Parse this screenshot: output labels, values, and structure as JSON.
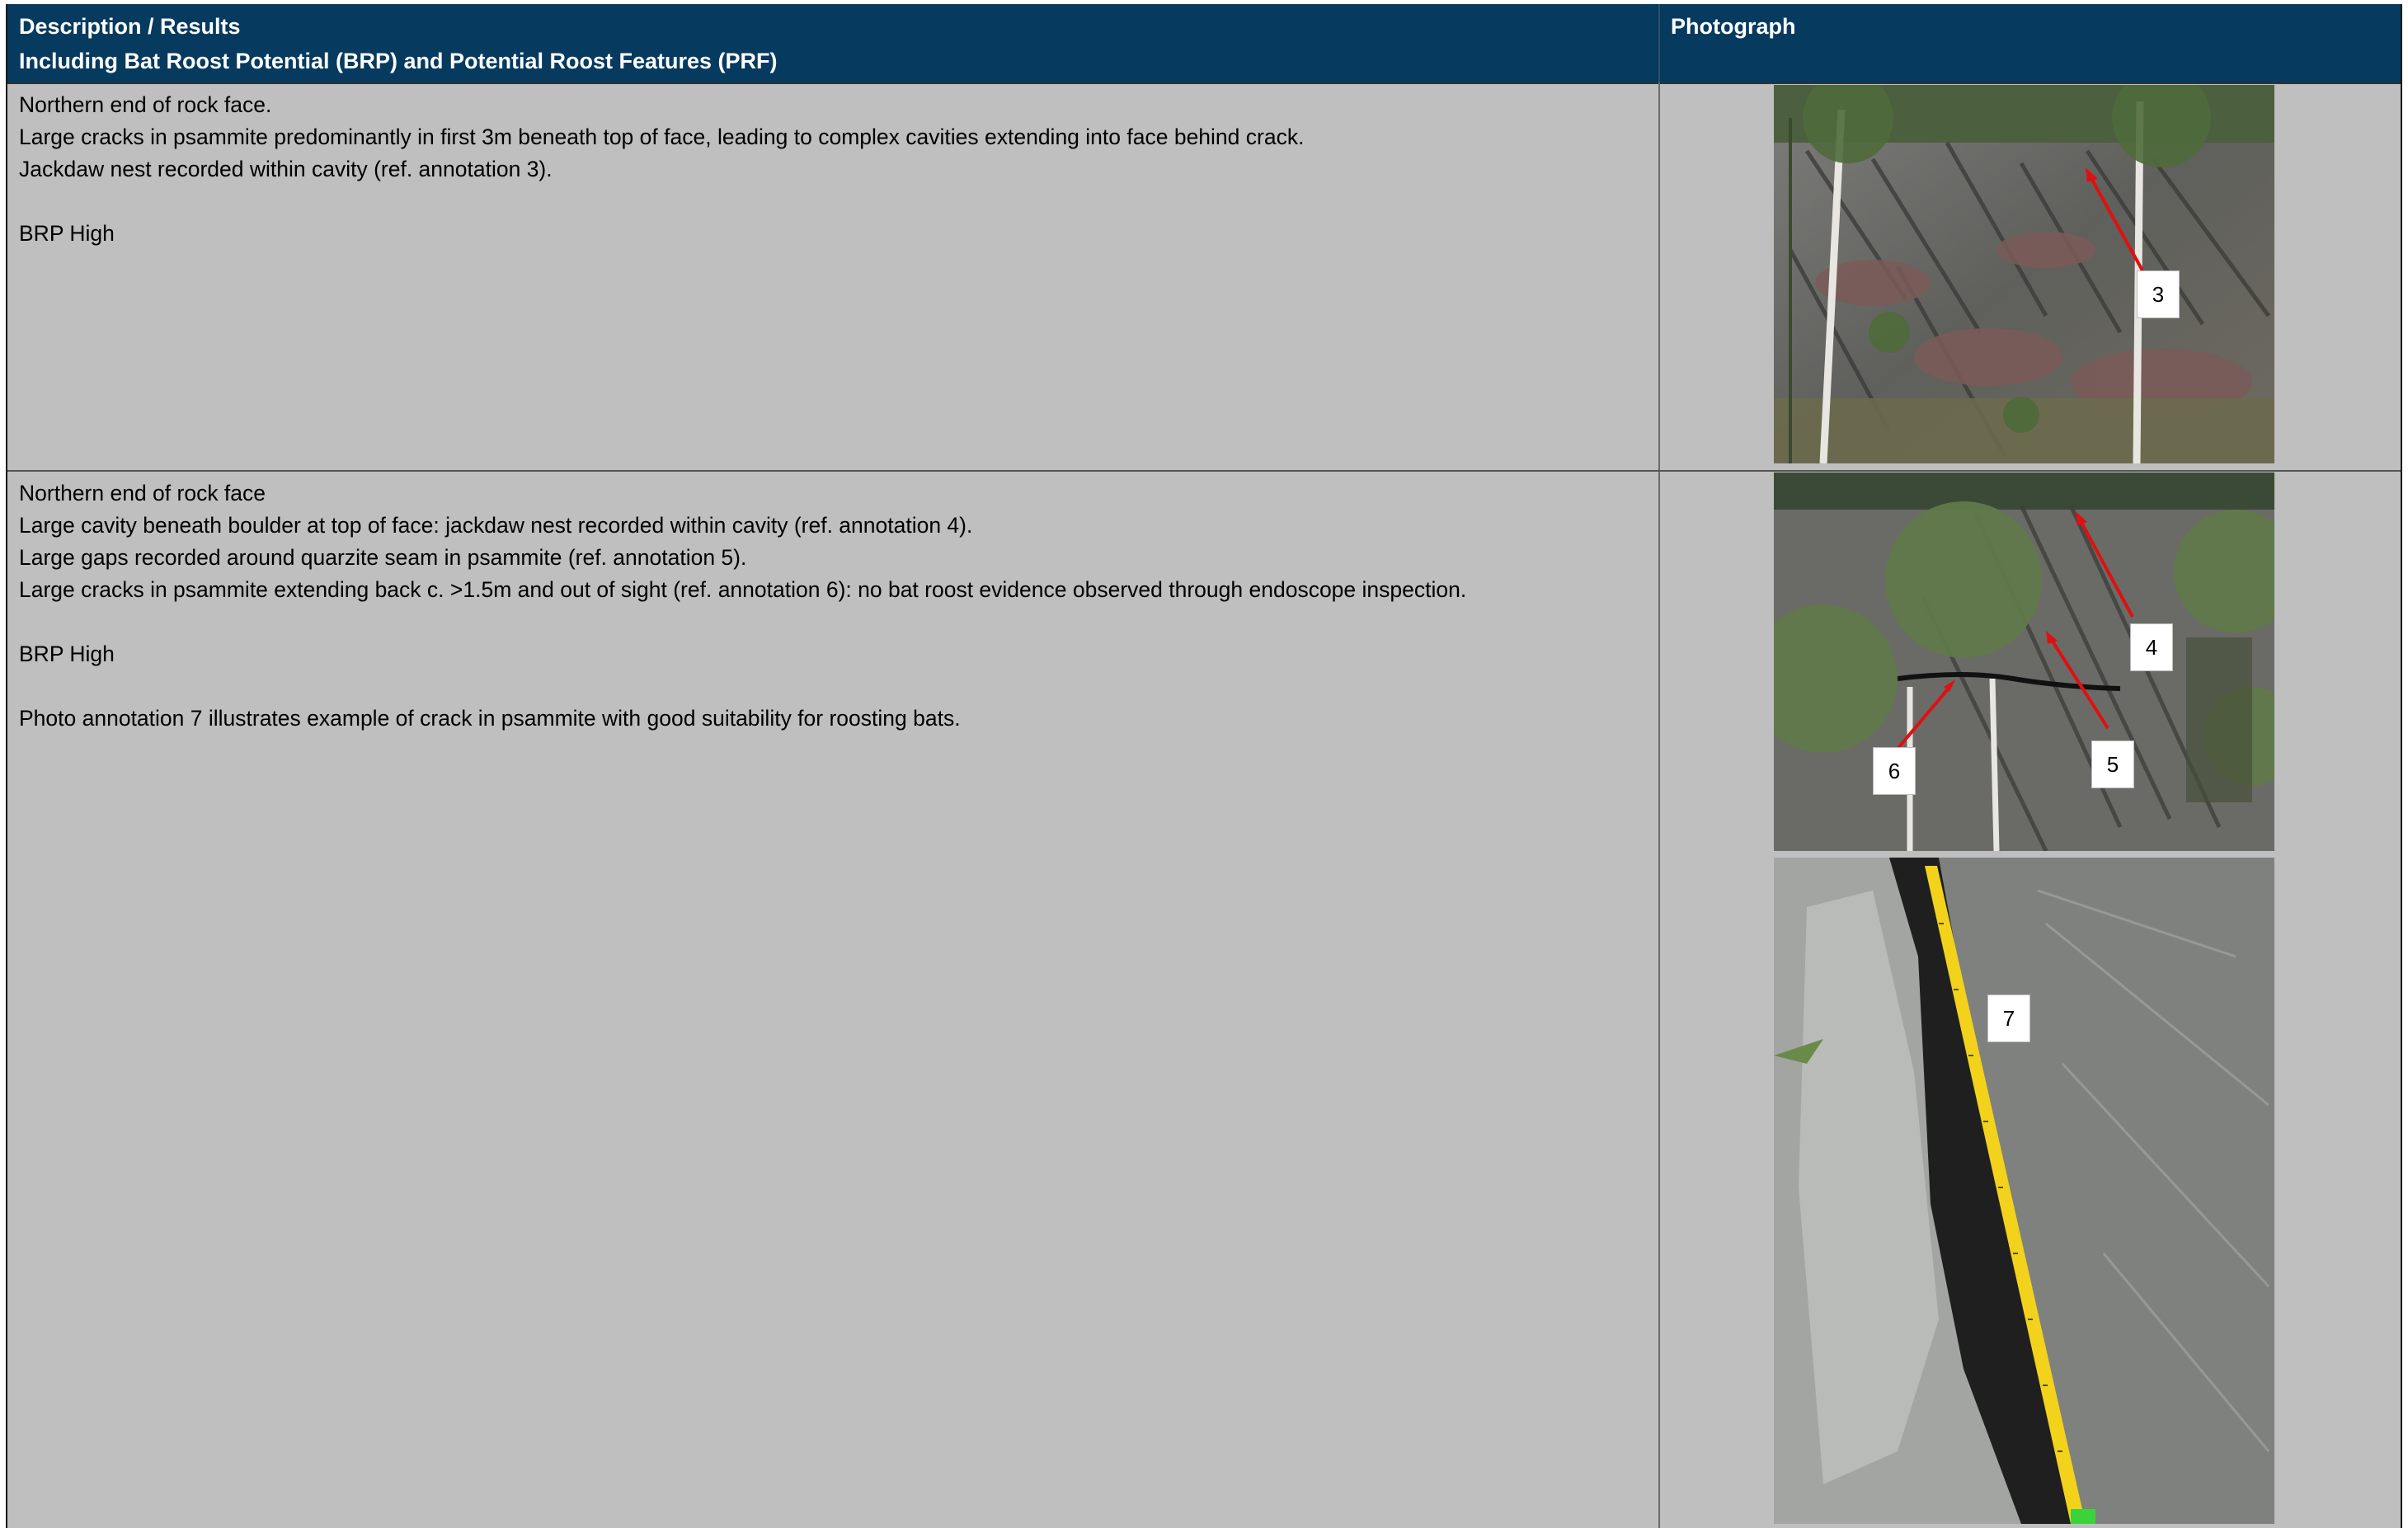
{
  "header": {
    "col1_line1": "Description / Results",
    "col1_line2": "Including Bat Roost Potential (BRP) and Potential Roost Features (PRF)",
    "col2": "Photograph"
  },
  "rows": [
    {
      "description": "Northern end of rock face.\nLarge cracks in psammite predominantly in first 3m beneath top of face, leading to complex cavities extending into face behind crack.\nJackdaw nest recorded within cavity (ref. annotation 3).\n\nBRP High",
      "photo_annotations": [
        "3"
      ]
    },
    {
      "description": "Northern end of rock face\nLarge cavity beneath boulder at top of face: jackdaw nest recorded within cavity (ref. annotation 4).\nLarge gaps recorded around quarzite seam in psammite (ref. annotation 5).\nLarge cracks in psammite extending back c. >1.5m and out of sight (ref. annotation 6): no bat roost evidence observed through endoscope inspection.\n\nBRP High\n\nPhoto annotation 7 illustrates example of crack in psammite with good suitability for roosting bats.",
      "photo_annotations": [
        "4",
        "5",
        "6"
      ],
      "photo2_annotations": [
        "7"
      ]
    }
  ],
  "colors": {
    "header_bg": "#063a5f",
    "cell_bg": "#bfbfbf",
    "arrow": "#e01010",
    "tape": "#f2d21b"
  }
}
